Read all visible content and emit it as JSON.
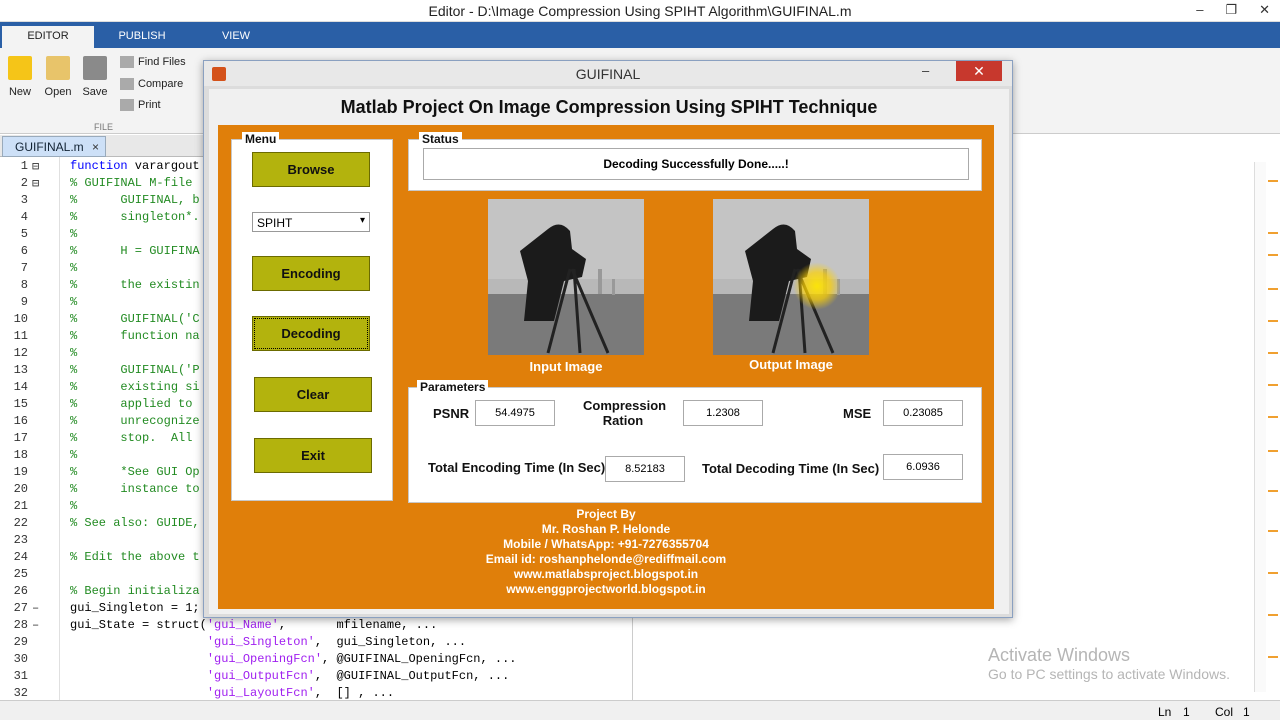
{
  "window": {
    "title": "Editor - D:\\Image Compression Using SPIHT Algorithm\\GUIFINAL.m"
  },
  "ribbon": {
    "tabs": [
      "EDITOR",
      "PUBLISH",
      "VIEW"
    ],
    "new_label": "New",
    "open_label": "Open",
    "save_label": "Save",
    "find_files_label": "Find Files",
    "compare_label": "Compare",
    "print_label": "Print",
    "file_group_label": "FILE"
  },
  "doc_tab": {
    "label": "GUIFINAL.m",
    "close": "×"
  },
  "editor_lines": [
    {
      "n": "1",
      "mk": "⊟",
      "parts": [
        {
          "c": "kw",
          "t": "function"
        },
        {
          "c": "",
          "t": " varargout"
        }
      ]
    },
    {
      "n": "2",
      "mk": "⊟",
      "parts": [
        {
          "c": "cm",
          "t": "% GUIFINAL M-file"
        }
      ]
    },
    {
      "n": "3",
      "mk": "",
      "parts": [
        {
          "c": "cm",
          "t": "%      GUIFINAL, b"
        }
      ]
    },
    {
      "n": "4",
      "mk": "",
      "parts": [
        {
          "c": "cm",
          "t": "%      singleton*."
        }
      ]
    },
    {
      "n": "5",
      "mk": "",
      "parts": [
        {
          "c": "cm",
          "t": "%"
        }
      ]
    },
    {
      "n": "6",
      "mk": "",
      "parts": [
        {
          "c": "cm",
          "t": "%      H = GUIFINA"
        }
      ]
    },
    {
      "n": "7",
      "mk": "",
      "parts": [
        {
          "c": "cm",
          "t": "%"
        }
      ]
    },
    {
      "n": "8",
      "mk": "",
      "parts": [
        {
          "c": "cm",
          "t": "%      the existin"
        }
      ]
    },
    {
      "n": "9",
      "mk": "",
      "parts": [
        {
          "c": "cm",
          "t": "%"
        }
      ]
    },
    {
      "n": "10",
      "mk": "",
      "parts": [
        {
          "c": "cm",
          "t": "%      GUIFINAL('C"
        }
      ]
    },
    {
      "n": "11",
      "mk": "",
      "parts": [
        {
          "c": "cm",
          "t": "%      function na"
        }
      ]
    },
    {
      "n": "12",
      "mk": "",
      "parts": [
        {
          "c": "cm",
          "t": "%"
        }
      ]
    },
    {
      "n": "13",
      "mk": "",
      "parts": [
        {
          "c": "cm",
          "t": "%      GUIFINAL('P"
        }
      ]
    },
    {
      "n": "14",
      "mk": "",
      "parts": [
        {
          "c": "cm",
          "t": "%      existing si"
        }
      ]
    },
    {
      "n": "15",
      "mk": "",
      "parts": [
        {
          "c": "cm",
          "t": "%      applied to"
        }
      ]
    },
    {
      "n": "16",
      "mk": "",
      "parts": [
        {
          "c": "cm",
          "t": "%      unrecognize"
        }
      ]
    },
    {
      "n": "17",
      "mk": "",
      "parts": [
        {
          "c": "cm",
          "t": "%      stop.  All"
        }
      ]
    },
    {
      "n": "18",
      "mk": "",
      "parts": [
        {
          "c": "cm",
          "t": "%"
        }
      ]
    },
    {
      "n": "19",
      "mk": "",
      "parts": [
        {
          "c": "cm",
          "t": "%      *See GUI Op"
        }
      ]
    },
    {
      "n": "20",
      "mk": "",
      "parts": [
        {
          "c": "cm",
          "t": "%      instance to"
        }
      ]
    },
    {
      "n": "21",
      "mk": "",
      "parts": [
        {
          "c": "cm",
          "t": "%"
        }
      ]
    },
    {
      "n": "22",
      "mk": "",
      "parts": [
        {
          "c": "cm",
          "t": "% See also: GUIDE,"
        }
      ]
    },
    {
      "n": "23",
      "mk": "",
      "parts": []
    },
    {
      "n": "24",
      "mk": "",
      "parts": [
        {
          "c": "cm",
          "t": "% Edit the above t"
        }
      ]
    },
    {
      "n": "25",
      "mk": "",
      "parts": []
    },
    {
      "n": "26",
      "mk": "",
      "parts": [
        {
          "c": "cm",
          "t": "% Begin initializa"
        }
      ]
    },
    {
      "n": "27",
      "mk": "–",
      "parts": [
        {
          "c": "",
          "t": "gui_Singleton = 1;"
        }
      ]
    },
    {
      "n": "28",
      "mk": "–",
      "parts": [
        {
          "c": "",
          "t": "gui_State = struct("
        },
        {
          "c": "st",
          "t": "'gui_Name'"
        },
        {
          "c": "",
          "t": ",       mfilename, ..."
        }
      ]
    },
    {
      "n": "29",
      "mk": "",
      "parts": [
        {
          "c": "",
          "t": "                   "
        },
        {
          "c": "st",
          "t": "'gui_Singleton'"
        },
        {
          "c": "",
          "t": ",  gui_Singleton, ..."
        }
      ]
    },
    {
      "n": "30",
      "mk": "",
      "parts": [
        {
          "c": "",
          "t": "                   "
        },
        {
          "c": "st",
          "t": "'gui_OpeningFcn'"
        },
        {
          "c": "",
          "t": ", @GUIFINAL_OpeningFcn, ..."
        }
      ]
    },
    {
      "n": "31",
      "mk": "",
      "parts": [
        {
          "c": "",
          "t": "                   "
        },
        {
          "c": "st",
          "t": "'gui_OutputFcn'"
        },
        {
          "c": "",
          "t": ",  @GUIFINAL_OutputFcn, ..."
        }
      ]
    },
    {
      "n": "32",
      "mk": "",
      "parts": [
        {
          "c": "",
          "t": "                   "
        },
        {
          "c": "st",
          "t": "'gui_LayoutFcn'"
        },
        {
          "c": "",
          "t": ",  [] , ..."
        }
      ]
    }
  ],
  "gui": {
    "title": "GUIFINAL",
    "heading": "Matlab Project On Image Compression Using SPIHT Technique",
    "menu_label": "Menu",
    "browse": "Browse",
    "method_selected": "SPIHT",
    "encoding": "Encoding",
    "decoding": "Decoding",
    "clear": "Clear",
    "exit": "Exit",
    "status_label": "Status",
    "status_text": "Decoding Successfully Done.....!",
    "input_image_label": "Input Image",
    "output_image_label": "Output Image",
    "params_label": "Parameters",
    "psnr_label": "PSNR",
    "psnr_value": "54.4975",
    "cr_label_1": "Compression",
    "cr_label_2": "Ration",
    "cr_value": "1.2308",
    "mse_label": "MSE",
    "mse_value": "0.23085",
    "enc_time_label": "Total Encoding Time (In Sec)",
    "enc_time_value": "8.52183",
    "dec_time_label": "Total Decoding Time (In Sec)",
    "dec_time_value": "6.0936",
    "credits": [
      "Project By",
      "Mr. Roshan P. Helonde",
      "Mobile / WhatsApp: +91-7276355704",
      "Email id: roshanphelonde@rediffmail.com",
      "www.matlabsproject.blogspot.in",
      "www.enggprojectworld.blogspot.in"
    ]
  },
  "watermark": {
    "line1": "Activate Windows",
    "line2": "Go to PC settings to activate Windows."
  },
  "statusbar": {
    "ln_label": "Ln",
    "ln": "1",
    "col_label": "Col",
    "col": "1"
  }
}
